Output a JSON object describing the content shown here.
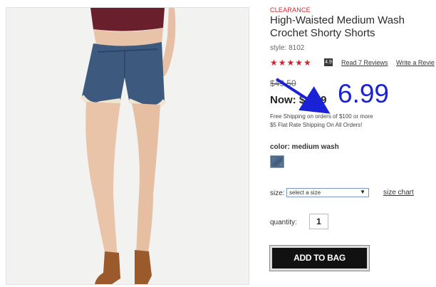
{
  "product": {
    "badge": "CLEARANCE",
    "title": "High-Waisted Medium Wash\nCrochet Shorty Shorts",
    "style": "style: 8102",
    "stars": "★★★★★",
    "rating": "4.9",
    "read_reviews": "Read 7 Reviews",
    "write_review": "Write a Revie"
  },
  "pricing": {
    "old_price": "$49.50",
    "now_price": "Now: $",
    "now_price_tail": "9"
  },
  "shipping": {
    "line1": "Free Shipping on orders of $100 or more",
    "line2": "$5 Flat Rate Shipping On All Orders!"
  },
  "color": {
    "label": "color: medium wash",
    "swatch_color": "#4d6a88"
  },
  "size": {
    "label": "size:",
    "select_value": "select a size",
    "chart_link": "size chart"
  },
  "quantity": {
    "label": "quantity:",
    "value": "1"
  },
  "cta": {
    "add_to_bag": "ADD TO BAG"
  },
  "annotation": {
    "new_price": "6.99",
    "color": "#1a22d8"
  }
}
